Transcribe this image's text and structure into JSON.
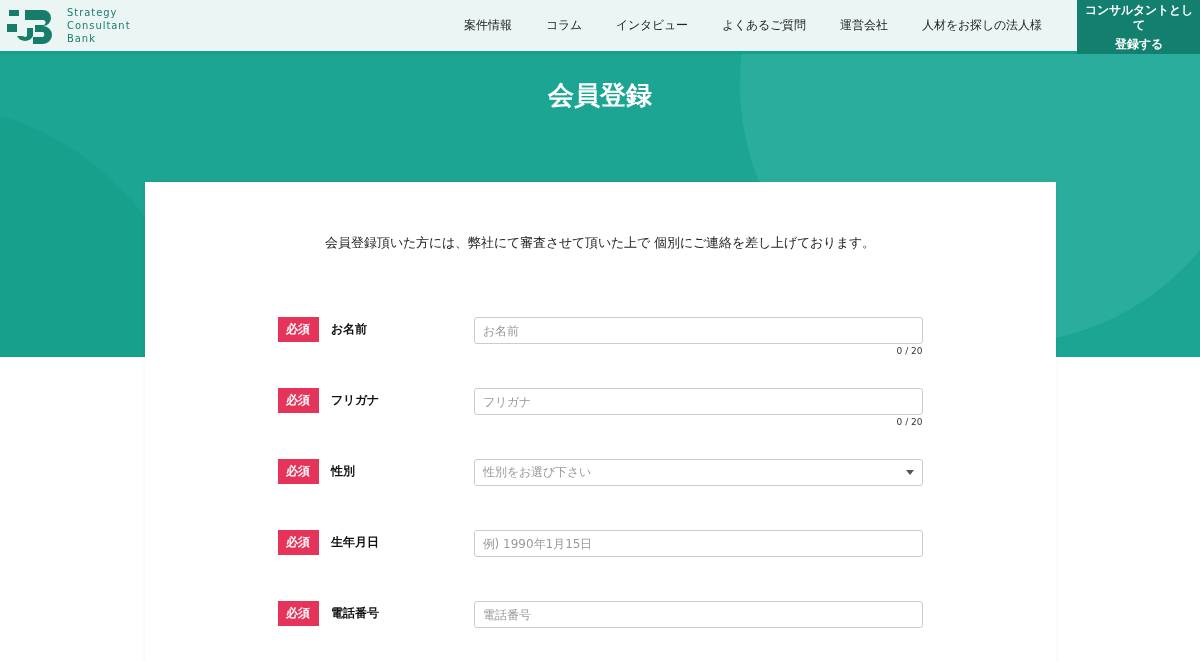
{
  "header": {
    "logo_text": [
      "Strategy",
      "Consultant",
      "Bank"
    ],
    "nav": [
      {
        "label": "案件情報"
      },
      {
        "label": "コラム"
      },
      {
        "label": "インタビュー"
      },
      {
        "label": "よくあるご質問"
      },
      {
        "label": "運営会社"
      },
      {
        "label": "人材をお探しの法人様"
      }
    ],
    "cta": [
      "コンサルタントとして",
      "登録する"
    ]
  },
  "page_title": "会員登録",
  "intro": "会員登録頂いた方には、弊社にて審査させて頂いた上で 個別にご連絡を差し上げております。",
  "form": [
    {
      "kind": "text",
      "required": true,
      "badge": "必須",
      "label": "お名前",
      "placeholder": "お名前",
      "counter": "0 / 20"
    },
    {
      "kind": "text",
      "required": true,
      "badge": "必須",
      "label": "フリガナ",
      "placeholder": "フリガナ",
      "counter": "0 / 20"
    },
    {
      "kind": "select",
      "required": true,
      "badge": "必須",
      "label": "性別",
      "placeholder": "性別をお選び下さい"
    },
    {
      "kind": "text",
      "required": true,
      "badge": "必須",
      "label": "生年月日",
      "placeholder": "例) 1990年1月15日"
    },
    {
      "kind": "text",
      "required": true,
      "badge": "必須",
      "label": "電話番号",
      "placeholder": "電話番号"
    }
  ]
}
